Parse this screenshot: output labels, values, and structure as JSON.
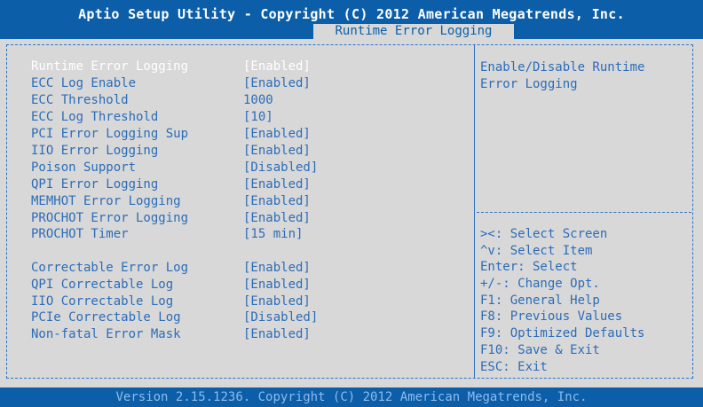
{
  "header": {
    "title": "Aptio Setup Utility - Copyright (C) 2012 American Megatrends, Inc.",
    "active_tab": "Runtime Error Logging"
  },
  "settings": [
    {
      "label": "Runtime Error Logging",
      "value": "[Enabled]",
      "state": "selected"
    },
    {
      "label": "ECC Log Enable",
      "value": "[Enabled]",
      "state": "normal"
    },
    {
      "label": "ECC Threshold",
      "value": "1000",
      "state": "readonly"
    },
    {
      "label": "ECC Log Threshold",
      "value": "[10]",
      "state": "normal"
    },
    {
      "label": "PCI Error Logging Sup",
      "value": "[Enabled]",
      "state": "normal"
    },
    {
      "label": "IIO Error Logging",
      "value": "[Enabled]",
      "state": "normal"
    },
    {
      "label": "Poison Support",
      "value": "[Disabled]",
      "state": "normal"
    },
    {
      "label": "QPI Error Logging",
      "value": "[Enabled]",
      "state": "normal"
    },
    {
      "label": "MEMHOT Error Logging",
      "value": "[Enabled]",
      "state": "normal"
    },
    {
      "label": "PROCHOT Error Logging",
      "value": "[Enabled]",
      "state": "normal"
    },
    {
      "label": "PROCHOT Timer",
      "value": "[15 min]",
      "state": "normal"
    },
    {
      "label": "Correctable Error Log",
      "value": "[Enabled]",
      "state": "normal"
    },
    {
      "label": "QPI Correctable Log",
      "value": "[Enabled]",
      "state": "normal"
    },
    {
      "label": "IIO Correctable Log",
      "value": "[Enabled]",
      "state": "normal"
    },
    {
      "label": "PCIe Correctable Log",
      "value": "[Disabled]",
      "state": "normal"
    },
    {
      "label": "Non-fatal Error Mask",
      "value": "[Enabled]",
      "state": "normal"
    }
  ],
  "help": {
    "line1": "Enable/Disable Runtime",
    "line2": "Error Logging"
  },
  "keys": [
    "><: Select Screen",
    "^v: Select Item",
    "Enter: Select",
    "+/-: Change Opt.",
    "F1: General Help",
    "F8: Previous Values",
    "F9: Optimized Defaults",
    "F10: Save & Exit",
    "ESC: Exit"
  ],
  "footer": "Version 2.15.1236. Copyright (C) 2012 American Megatrends, Inc.",
  "colors": {
    "header_bg": "#0c5ea8",
    "panel_bg": "#d8d8d8",
    "text_blue": "#2c6cb8",
    "selected_text": "#ffffff"
  }
}
